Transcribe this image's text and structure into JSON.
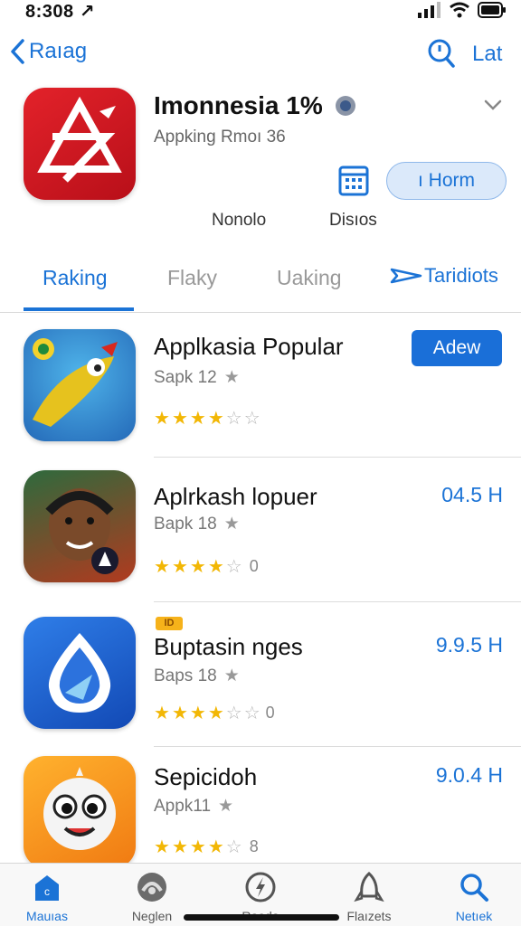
{
  "status_bar": {
    "time": "8:308 ↗"
  },
  "nav": {
    "back_label": "Raıag",
    "right_label": "Lat"
  },
  "app": {
    "name": "Imonnesia 1%",
    "subtitle": "Appking Rmoı 36",
    "get_label": "ı Horm",
    "meta_left": "Nonolo",
    "meta_right": "Disıos",
    "icon_color": "#d8161f"
  },
  "tabs": [
    {
      "label": "Raking"
    },
    {
      "label": "Flaky"
    },
    {
      "label": "Uaking"
    },
    {
      "label": "Taridiots"
    }
  ],
  "apps": [
    {
      "title": "Applkasia Popular",
      "sub": "Sapk 12",
      "stars_filled": 4,
      "stars_text": "",
      "action_label": "Adew",
      "price": ""
    },
    {
      "title": "Aplrkash lopuer",
      "sub": "Bapk 18",
      "stars_filled": 4,
      "stars_text": "0",
      "action_label": "",
      "price": "04.5 H"
    },
    {
      "title": "Buptasin nges",
      "sub": "Baps 18",
      "stars_filled": 4,
      "stars_text": "0",
      "action_label": "",
      "price": "9.9.5 H",
      "badge": "ID"
    },
    {
      "title": "Sepicidoh",
      "sub": "Appk11",
      "stars_filled": 4,
      "stars_text": "8",
      "action_label": "",
      "price": "9.0.4 H"
    }
  ],
  "tab_bar": [
    {
      "label": "Mauıas",
      "icon": "home-icon"
    },
    {
      "label": "Neglen",
      "icon": "game-controller-icon"
    },
    {
      "label": "Raoda",
      "icon": "lightning-icon"
    },
    {
      "label": "Flaızets",
      "icon": "rocket-icon"
    },
    {
      "label": "Netıek",
      "icon": "search-icon"
    }
  ],
  "colors": {
    "accent": "#1b73d6",
    "star": "#f2b705"
  }
}
